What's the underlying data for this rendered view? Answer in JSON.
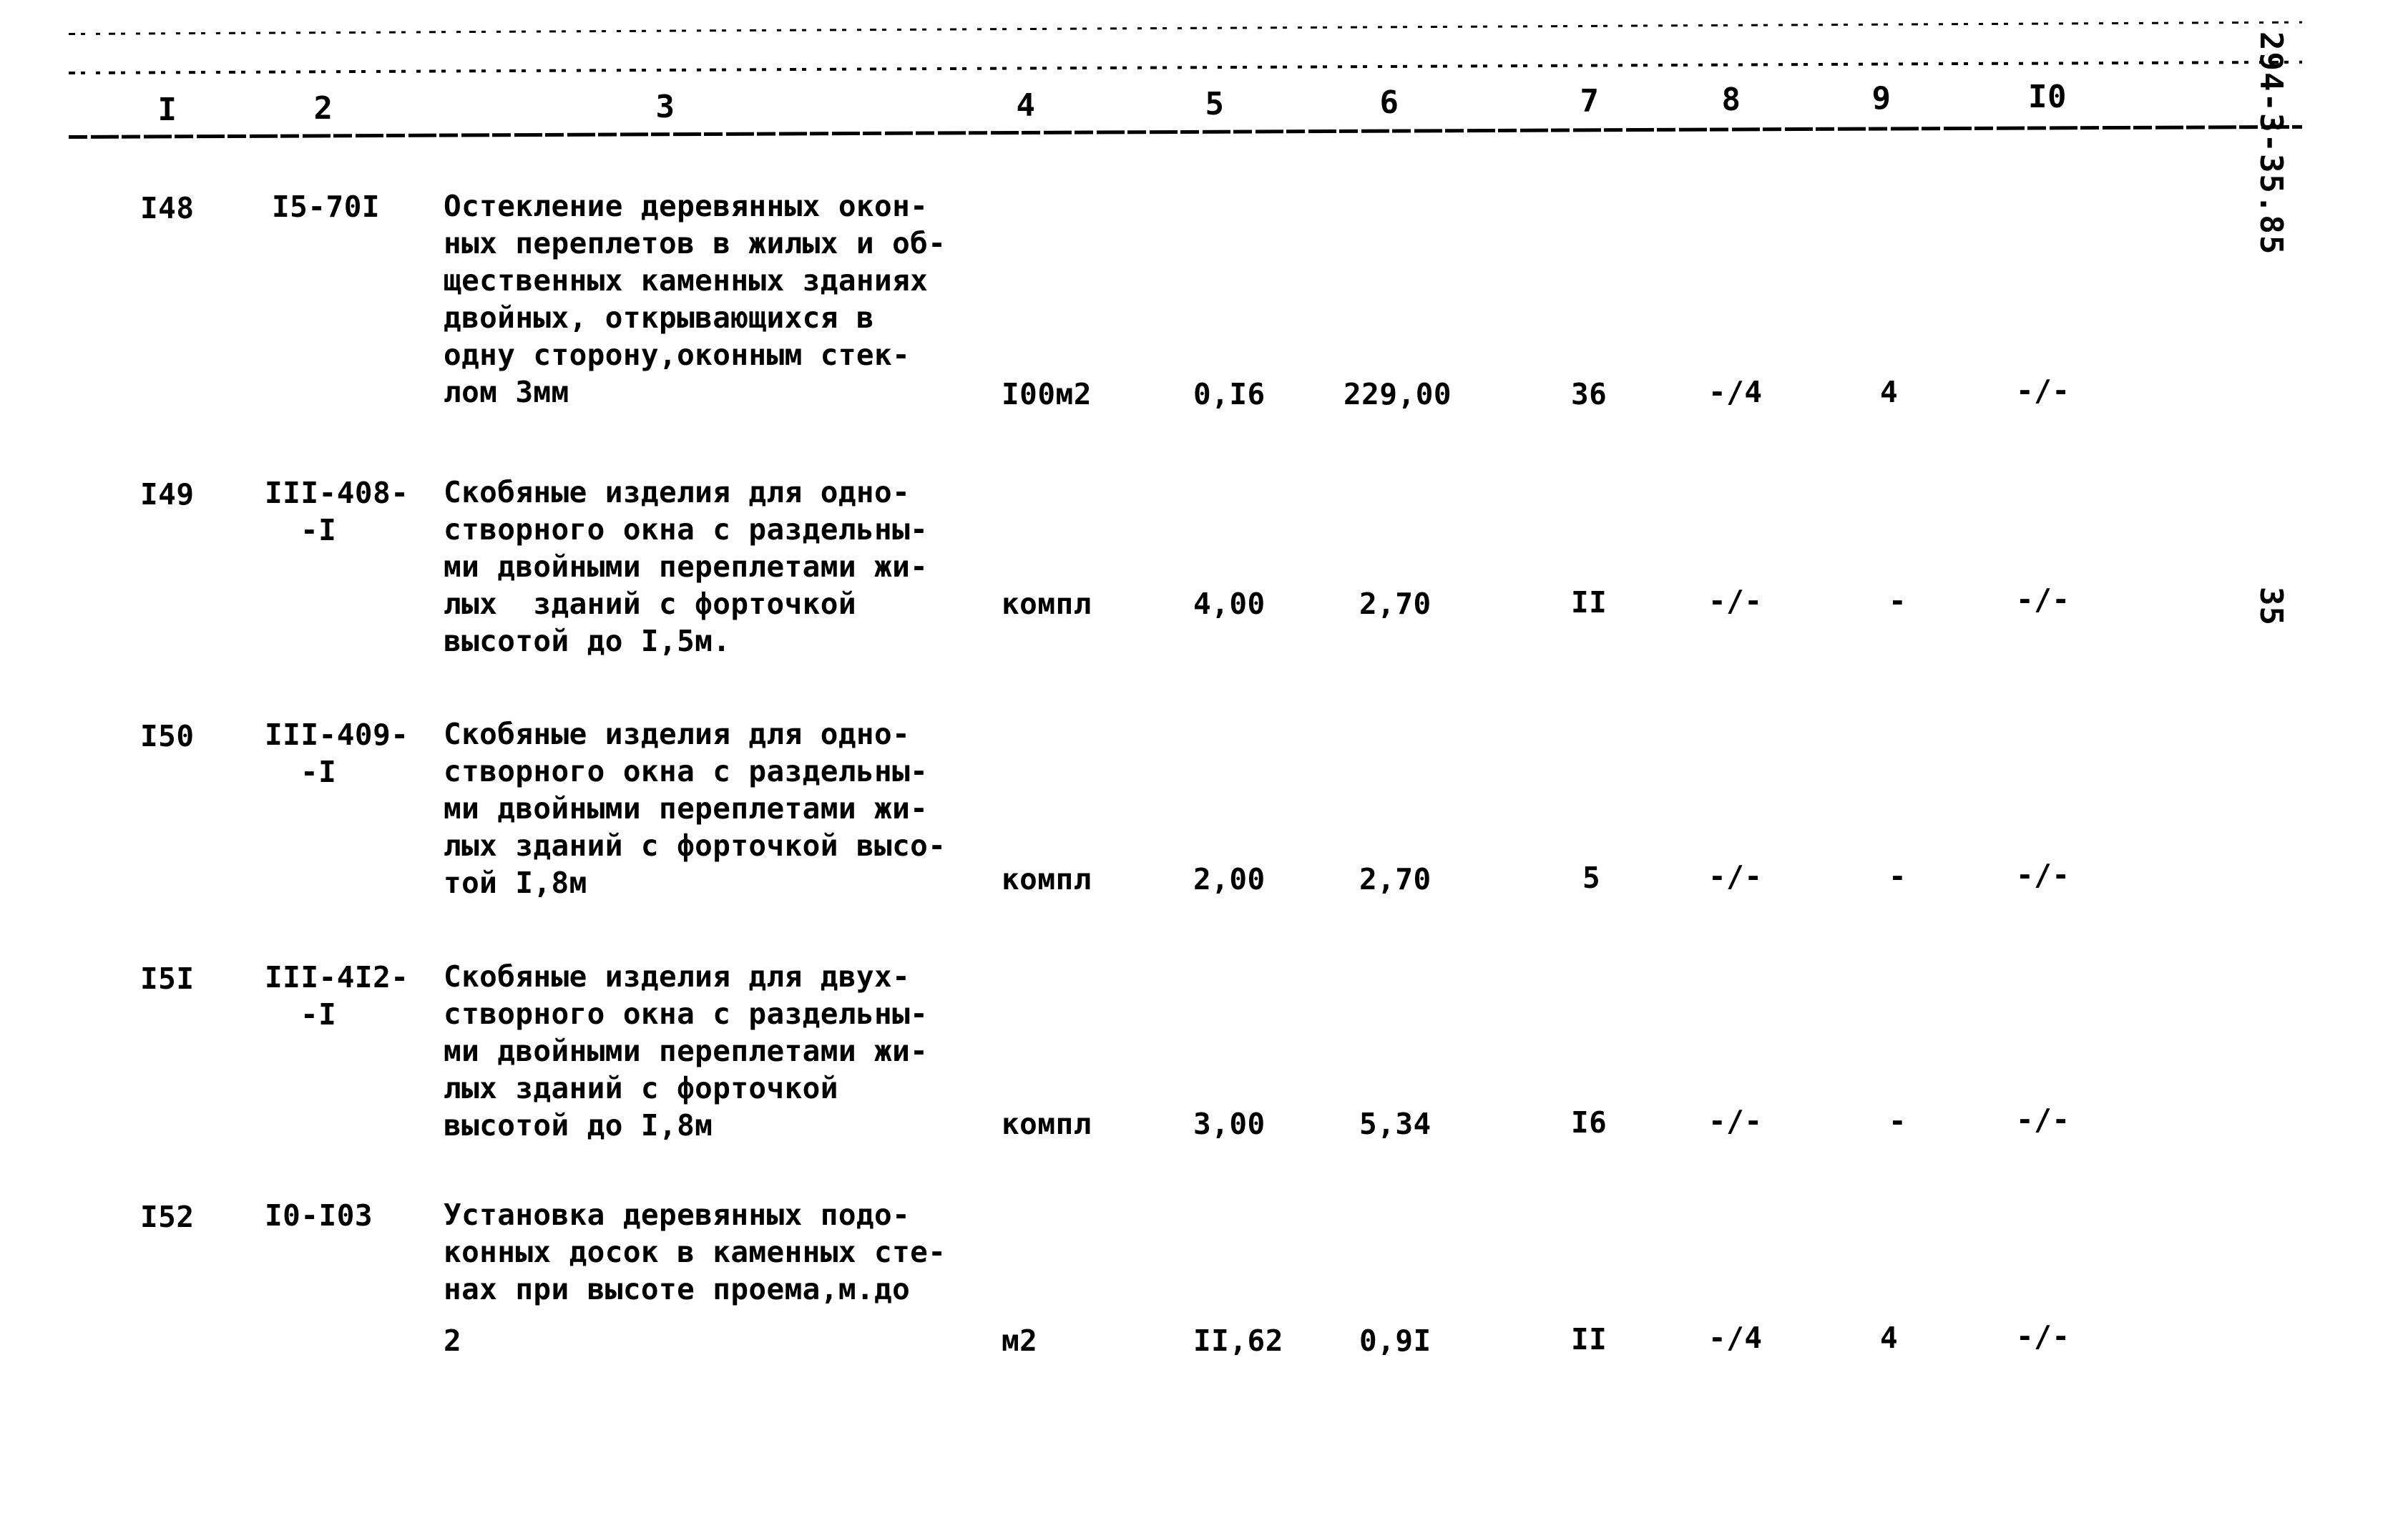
{
  "document": {
    "doc_code": "294-3-35.85",
    "page_number": "35"
  },
  "table": {
    "column_headers": [
      "I",
      "2",
      "3",
      "4",
      "5",
      "6",
      "7",
      "8",
      "9",
      "I0"
    ],
    "rows": [
      {
        "num": "I48",
        "code": "I5-70I",
        "code_line2": "",
        "description": [
          "Остекление деревянных окон-",
          "ных переплетов в жилых и об-",
          "щественных каменных зданиях",
          "двойных, открывающихся в",
          "одну сторону,оконным стек-",
          "лом 3мм"
        ],
        "unit": "I00м2",
        "c5": "0,I6",
        "c6": "229,00",
        "c7": "36",
        "c8": "-/4",
        "c9": "4",
        "c10": "-/-"
      },
      {
        "num": "I49",
        "code": "III-408-",
        "code_line2": "-I",
        "description": [
          "Скобяные изделия для одно-",
          "створного окна с раздельны-",
          "ми двойными переплетами жи-",
          "лых  зданий с форточкой",
          "высотой до I,5м."
        ],
        "unit": "компл",
        "c5": "4,00",
        "c6": "2,70",
        "c7": "II",
        "c8": "-/-",
        "c9": "-",
        "c10": "-/-"
      },
      {
        "num": "I50",
        "code": "III-409-",
        "code_line2": "-I",
        "description": [
          "Скобяные изделия для одно-",
          "створного окна с раздельны-",
          "ми двойными переплетами жи-",
          "лых зданий с форточкой высо-",
          "той I,8м"
        ],
        "unit": "компл",
        "c5": "2,00",
        "c6": "2,70",
        "c7": "5",
        "c8": "-/-",
        "c9": "-",
        "c10": "-/-"
      },
      {
        "num": "I5I",
        "code": "III-4I2-",
        "code_line2": "-I",
        "description": [
          "Скобяные изделия для двух-",
          "створного окна с раздельны-",
          "ми двойными переплетами жи-",
          "лых зданий с форточкой",
          "высотой до I,8м"
        ],
        "unit": "компл",
        "c5": "3,00",
        "c6": "5,34",
        "c7": "I6",
        "c8": "-/-",
        "c9": "-",
        "c10": "-/-"
      },
      {
        "num": "I52",
        "code": "I0-I03",
        "code_line2": "",
        "description": [
          "Установка деревянных подо-",
          "конных досок в каменных сте-",
          "нах при высоте проема,м.до",
          "",
          "2"
        ],
        "unit": "м2",
        "c5": "II,62",
        "c6": "0,9I",
        "c7": "II",
        "c8": "-/4",
        "c9": "4",
        "c10": "-/-"
      }
    ]
  }
}
